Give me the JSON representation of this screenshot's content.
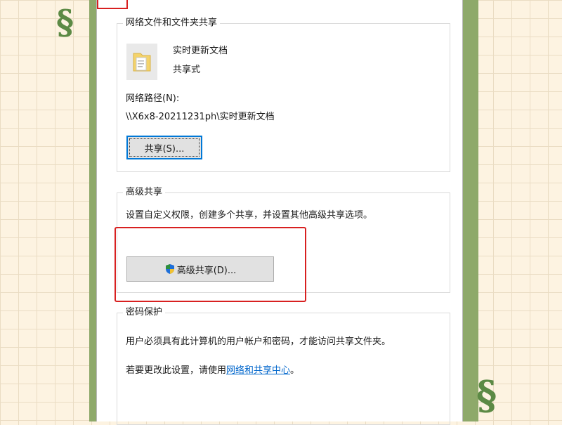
{
  "network_group": {
    "title": "网络文件和文件夹共享",
    "folder_name": "实时更新文档",
    "share_status": "共享式",
    "path_label": "网络路径(N):",
    "path_value": "\\\\X6x8-20211231ph\\实时更新文档",
    "share_button": "共享(S)..."
  },
  "advanced_group": {
    "title": "高级共享",
    "description": "设置自定义权限，创建多个共享，并设置其他高级共享选项。",
    "button": "高级共享(D)..."
  },
  "password_group": {
    "title": "密码保护",
    "description": "用户必须具有此计算机的用户帐户和密码，才能访问共享文件夹。",
    "change_prefix": "若要更改此设置，请使用",
    "link": "网络和共享中心",
    "change_suffix": "。"
  },
  "colors": {
    "highlight": "#d82020",
    "link": "#0066cc",
    "focus": "#0078d7"
  },
  "icons": [
    "folder-icon",
    "uac-shield-icon"
  ]
}
